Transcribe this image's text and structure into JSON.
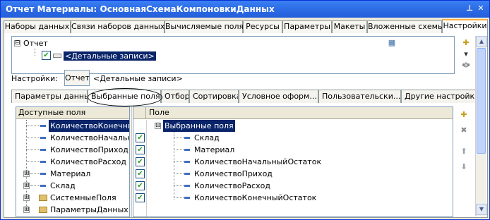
{
  "window": {
    "title": "Отчет Материалы: ОсновнаяСхемаКомпоновкиДанных",
    "pin_glyph": "⊥",
    "close_glyph": "✕"
  },
  "tabs": [
    {
      "label": "Наборы данных"
    },
    {
      "label": "Связи наборов данных"
    },
    {
      "label": "Вычисляемые поля"
    },
    {
      "label": "Ресурсы"
    },
    {
      "label": "Параметры"
    },
    {
      "label": "Макеты"
    },
    {
      "label": "Вложенные схемы"
    },
    {
      "label": "Настройки"
    }
  ],
  "structure": {
    "root_label": "Отчет",
    "child_label": "<Детальные записи>",
    "root_expander": "⊟"
  },
  "settings": {
    "label": "Настройки:",
    "button_label": "Отчет",
    "value": "<Детальные записи>"
  },
  "subtabs": [
    {
      "label": "Параметры данных"
    },
    {
      "label": "Выбранные поля"
    },
    {
      "label": "Отбор"
    },
    {
      "label": "Сортировка"
    },
    {
      "label": "Условное оформ..."
    },
    {
      "label": "Пользовательски..."
    },
    {
      "label": "Другие настройки"
    }
  ],
  "available": {
    "header": "Доступные поля",
    "items": [
      {
        "label": "КоличествоКонечныйОстаток",
        "type": "field",
        "expander": ""
      },
      {
        "label": "КоличествоНачальныйОстаток",
        "type": "field",
        "expander": ""
      },
      {
        "label": "КоличествоПриход",
        "type": "field",
        "expander": ""
      },
      {
        "label": "КоличествоРасход",
        "type": "field",
        "expander": ""
      },
      {
        "label": "Материал",
        "type": "field",
        "expander": "⊞"
      },
      {
        "label": "Склад",
        "type": "field",
        "expander": "⊞"
      },
      {
        "label": "СистемныеПоля",
        "type": "folder",
        "expander": "⊞"
      },
      {
        "label": "ПараметрыДанных",
        "type": "folder",
        "expander": "⊞"
      }
    ]
  },
  "selected": {
    "header": "Поле",
    "root_label": "Выбранные поля",
    "root_expander": "⊟",
    "items": [
      {
        "label": "Склад",
        "checked": true
      },
      {
        "label": "Материал",
        "checked": true
      },
      {
        "label": "КоличествоНачальныйОстаток",
        "checked": true
      },
      {
        "label": "КоличествоПриход",
        "checked": true
      },
      {
        "label": "КоличествоРасход",
        "checked": true
      },
      {
        "label": "КоличествоКонечныйОстаток",
        "checked": true
      }
    ],
    "check_glyph": "✔"
  },
  "glyphs": {
    "arrow_up": "⬆",
    "arrow_down": "⬇",
    "chevron_up": "︽",
    "chevron_down": "︾",
    "scroll_up": "▲",
    "scroll_down": "▼"
  }
}
